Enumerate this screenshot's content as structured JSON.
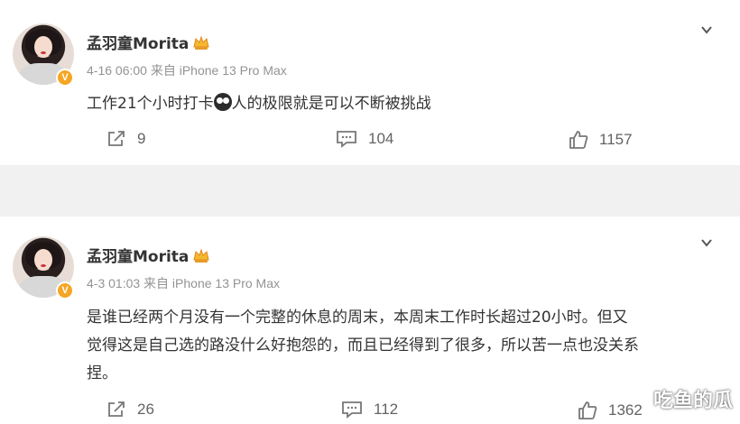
{
  "posts": [
    {
      "username": "孟羽童Morita",
      "meta": "4-16 06:00 来自 iPhone 13 Pro Max",
      "content_before": "工作21个小时打卡",
      "content_after": "人的极限就是可以不断被挑战",
      "reposts": "9",
      "comments": "104",
      "likes": "1157"
    },
    {
      "username": "孟羽童Morita",
      "meta": "4-3 01:03 来自 iPhone 13 Pro Max",
      "content_line1": "是谁已经两个月没有一个完整的休息的周末，本周末工作时长超过20小时。但又",
      "content_line2": "觉得这是自己选的路没什么好抱怨的，而且已经得到了很多，所以苦一点也没关系",
      "content_line3": "捏。",
      "reposts": "26",
      "comments": "112",
      "likes": "1362"
    }
  ],
  "watermark": "吃鱼的瓜",
  "colors": {
    "background": "#f1f1f1",
    "card": "#ffffff",
    "verified_badge": "#f5a623",
    "meta_text": "#939393"
  },
  "icons": [
    "verified-badge-icon",
    "crown-icon",
    "chevron-down-icon",
    "repost-icon",
    "comment-icon",
    "like-icon"
  ]
}
